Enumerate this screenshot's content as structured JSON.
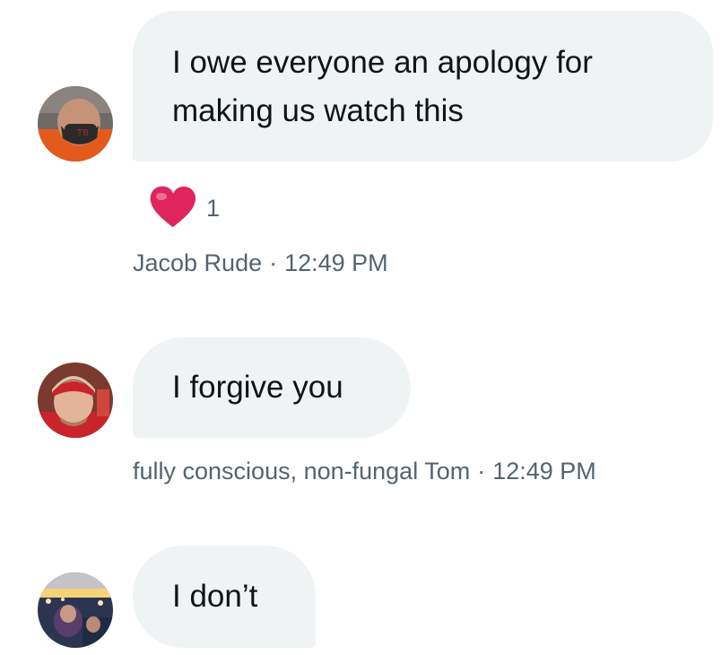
{
  "messages": [
    {
      "text": "I owe everyone an apology for making us watch this",
      "sender": "Jacob Rude",
      "time": "12:49 PM",
      "reaction": {
        "emoji": "heart",
        "count": "1"
      },
      "avatar_icon": "avatar-mask-icon"
    },
    {
      "text": "I forgive you",
      "sender": "fully conscious, non-fungal Tom",
      "time": "12:49 PM",
      "avatar_icon": "avatar-beanie-icon"
    },
    {
      "text": "I don’t",
      "avatar_icon": "avatar-stadium-icon"
    }
  ],
  "separator": "·",
  "colors": {
    "bubble_bg": "#eff3f4",
    "text": "#0f1419",
    "meta": "#536471",
    "heart": "#e0245e"
  }
}
